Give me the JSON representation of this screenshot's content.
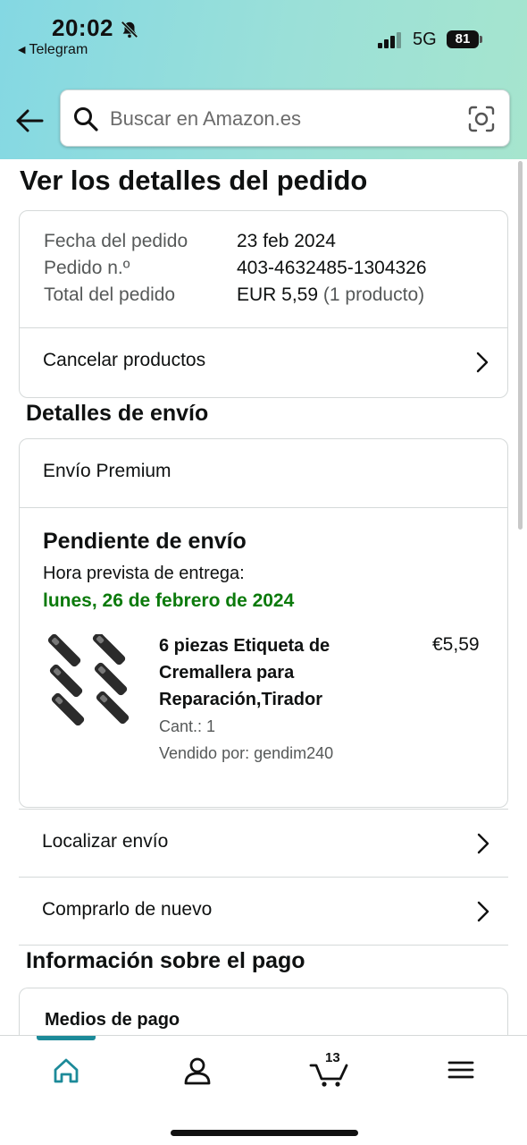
{
  "status_bar": {
    "time": "20:02",
    "back_app": "Telegram",
    "network": "5G",
    "battery": "81"
  },
  "search": {
    "placeholder": "Buscar en Amazon.es"
  },
  "page": {
    "title": "Ver los detalles del pedido"
  },
  "order_summary": {
    "rows": [
      {
        "label": "Fecha del pedido",
        "value": "23 feb 2024"
      },
      {
        "label": "Pedido n.º",
        "value": "403-4632485-1304326"
      },
      {
        "label": "Total del pedido",
        "value": "EUR 5,59",
        "value_extra": "(1 producto)"
      }
    ],
    "cancel_label": "Cancelar productos"
  },
  "shipping": {
    "section_title": "Detalles de envío",
    "type": "Envío Premium",
    "status": "Pendiente de envío",
    "eta_label": "Hora prevista de entrega:",
    "eta_date": "lunes, 26 de febrero de 2024",
    "eta_color": "#0b7a0b",
    "product": {
      "title": "6 piezas Etiqueta de Cremallera para Reparación,Tirador",
      "price": "€5,59",
      "qty": "Cant.: 1",
      "seller": "Vendido por: gendim240"
    },
    "track_label": "Localizar envío",
    "buy_again_label": "Comprarlo de nuevo"
  },
  "payment": {
    "section_title": "Información sobre el pago",
    "methods_title": "Medios de pago"
  },
  "bottom_nav": {
    "cart_count": "13",
    "accent_color": "#1c8a99",
    "items": [
      "home-icon",
      "account-icon",
      "cart-icon",
      "menu-icon"
    ]
  }
}
